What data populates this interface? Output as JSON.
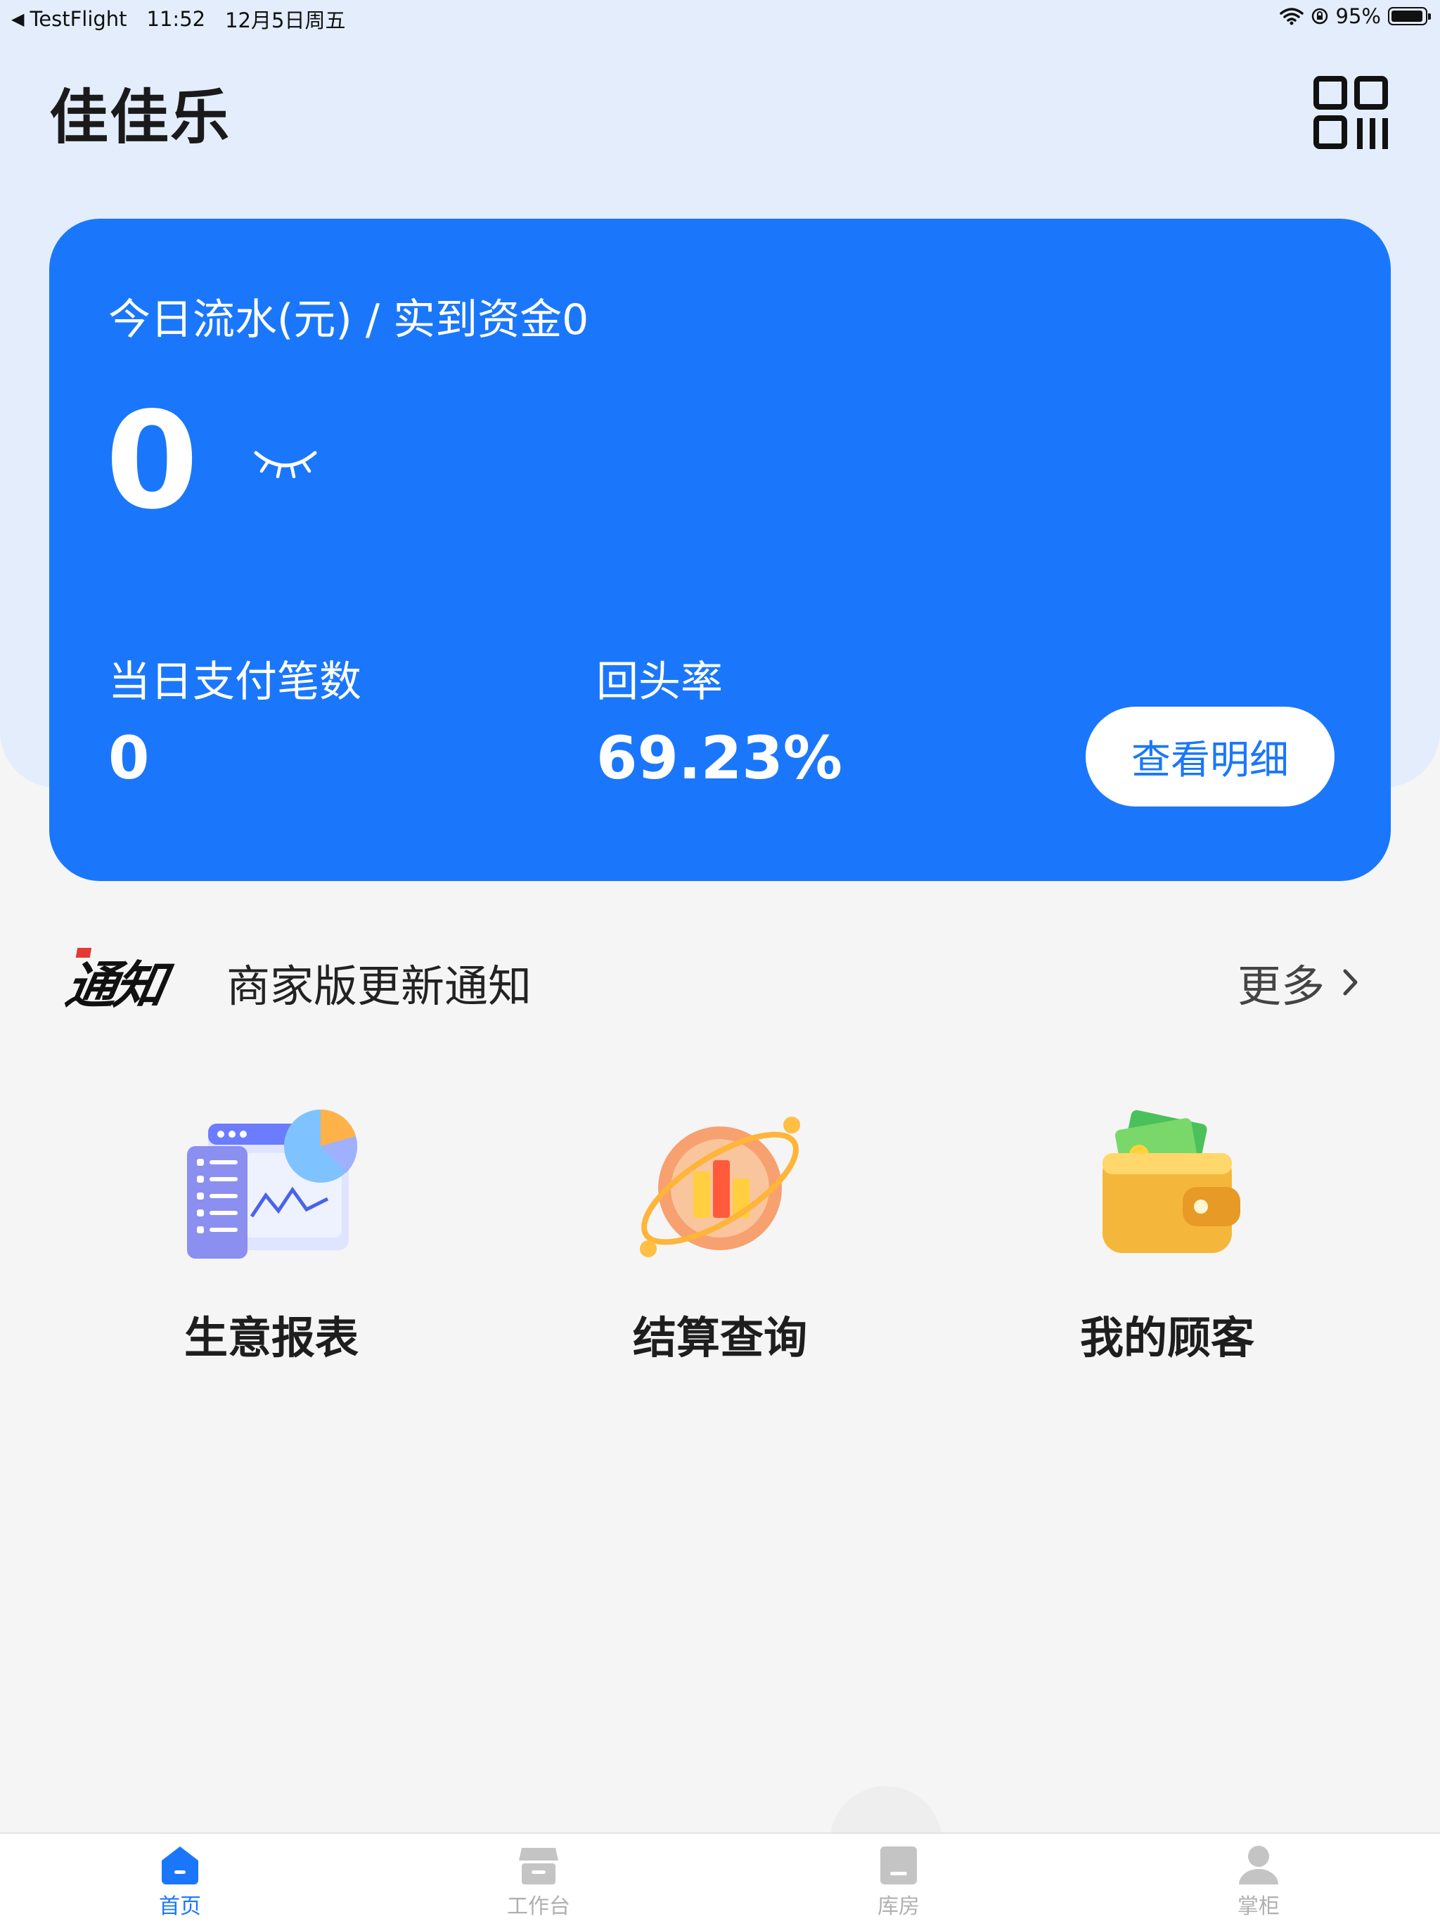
{
  "status_bar": {
    "back_app": "TestFlight",
    "time": "11:52",
    "date": "12月5日周五",
    "battery": "95%",
    "battery_level": 0.95
  },
  "header": {
    "title": "佳佳乐",
    "scan_icon": "qr-code-icon"
  },
  "summary_card": {
    "title": "今日流水(元) / 实到资金0",
    "amount": "0",
    "visibility_icon": "eye-closed-icon",
    "payment_count_label": "当日支付笔数",
    "payment_count": "0",
    "return_rate_label": "回头率",
    "return_rate": "69.23%",
    "detail_button": "查看明细",
    "background_color": "#1a77fb"
  },
  "notice": {
    "badge": "通知",
    "text": "商家版更新通知",
    "more": "更多"
  },
  "features": [
    {
      "label": "生意报表",
      "icon": "business-report-icon"
    },
    {
      "label": "结算查询",
      "icon": "settlement-query-icon"
    },
    {
      "label": "我的顾客",
      "icon": "wallet-customers-icon"
    }
  ],
  "tabs": [
    {
      "label": "首页",
      "icon": "home-icon",
      "active": true
    },
    {
      "label": "工作台",
      "icon": "workbench-store-icon",
      "active": false
    },
    {
      "label": "库房",
      "icon": "warehouse-icon",
      "active": false
    },
    {
      "label": "掌柜",
      "icon": "user-icon",
      "active": false
    }
  ],
  "colors": {
    "accent": "#1a77fb",
    "inactive_tab": "#b0b0b0",
    "header_bg": "#e3edfc"
  }
}
